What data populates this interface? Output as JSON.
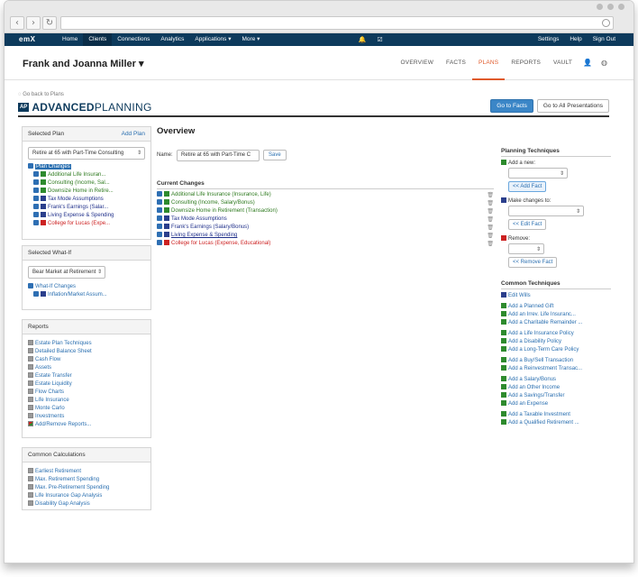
{
  "nav": {
    "logo": "emX",
    "items": [
      "Home",
      "Clients",
      "Connections",
      "Analytics",
      "Applications ▾",
      "More ▾"
    ],
    "active_item": "Clients",
    "right_items": [
      "Settings",
      "Help",
      "Sign Out"
    ]
  },
  "header": {
    "client_name": "Frank and Joanna Miller ▾",
    "tabs": [
      "OVERVIEW",
      "FACTS",
      "PLANS",
      "REPORTS",
      "VAULT"
    ],
    "active_tab": "PLANS"
  },
  "brand": {
    "back_link": "Go back to Plans",
    "badge": "AP",
    "name_bold": "ADVANCED",
    "name_rest": "PLANNING",
    "go_to_facts": "Go to Facts",
    "go_to_all_presentations": "Go to All Presentations"
  },
  "selected_plan": {
    "title": "Selected Plan",
    "add_plan": "Add Plan",
    "select_value": "Retire at 65 with Part-Time Consulting",
    "root": "Plan Changes",
    "items": [
      {
        "label": "Additional Life Insuran...",
        "color": "green"
      },
      {
        "label": "Consulting (Income, Sal...",
        "color": "green"
      },
      {
        "label": "Downsize Home in Retire...",
        "color": "green"
      },
      {
        "label": "Tax Mode Assumptions",
        "color": "blue"
      },
      {
        "label": "Frank's Earnings (Salar...",
        "color": "blue"
      },
      {
        "label": "Living Expense & Spending",
        "color": "blue"
      },
      {
        "label": "College for Lucas (Expe...",
        "color": "red"
      }
    ]
  },
  "selected_whatif": {
    "title": "Selected What-If",
    "select_value": "Bear Market at Retirement",
    "root": "What-If Changes",
    "item": "Inflation/Market Assum..."
  },
  "reports": {
    "title": "Reports",
    "items": [
      "Estate Plan Techniques",
      "Detailed Balance Sheet",
      "Cash Flow",
      "Assets",
      "Estate Transfer",
      "Estate Liquidity",
      "Flow Charts",
      "Life Insurance",
      "Monte Carlo",
      "Investments",
      "Add/Remove Reports..."
    ]
  },
  "calculations": {
    "title": "Common Calculations",
    "items": [
      "Earliest Retirement",
      "Max. Retirement Spending",
      "Max. Pre-Retirement Spending",
      "Life Insurance Gap Analysis",
      "Disability Gap Analysis"
    ]
  },
  "overview": {
    "title": "Overview",
    "name_label": "Name:",
    "name_value": "Retire at 65 with Part-Time C",
    "save": "Save",
    "current_changes_title": "Current Changes",
    "changes": [
      {
        "label": "Additional Life Insurance (Insurance, Life)",
        "color": "green"
      },
      {
        "label": "Consulting (Income, Salary/Bonus)",
        "color": "green"
      },
      {
        "label": "Downsize Home in Retirement (Transaction)",
        "color": "green"
      },
      {
        "label": "Tax Mode Assumptions",
        "color": "blue"
      },
      {
        "label": "Frank's Earnings (Salary/Bonus)",
        "color": "blue"
      },
      {
        "label": "Living Expense & Spending",
        "color": "blue"
      },
      {
        "label": "College for Lucas (Expense, Educational)",
        "color": "red"
      }
    ]
  },
  "planning": {
    "title": "Planning Techniques",
    "add_new": "Add a new:",
    "add_fact": "<< Add Fact",
    "make_changes": "Make changes to:",
    "edit_fact": "<< Edit Fact",
    "remove": "Remove:",
    "remove_fact": "<< Remove Fact"
  },
  "common_techniques": {
    "title": "Common Techniques",
    "groups": [
      [
        "Edit Wills"
      ],
      [
        "Add a Planned Gift",
        "Add an Irrev. Life Insuranc...",
        "Add a Charitable Remainder ..."
      ],
      [
        "Add a Life Insurance Policy",
        "Add a Disability Policy",
        "Add a Long-Term Care Policy"
      ],
      [
        "Add a Buy/Sell Transaction",
        "Add a Reinvestment Transac..."
      ],
      [
        "Add a Salary/Bonus",
        "Add an Other Income",
        "Add a Savings/Transfer",
        "Add an Expense"
      ],
      [
        "Add a Taxable Investment",
        "Add a Qualified Retirement ..."
      ]
    ]
  }
}
